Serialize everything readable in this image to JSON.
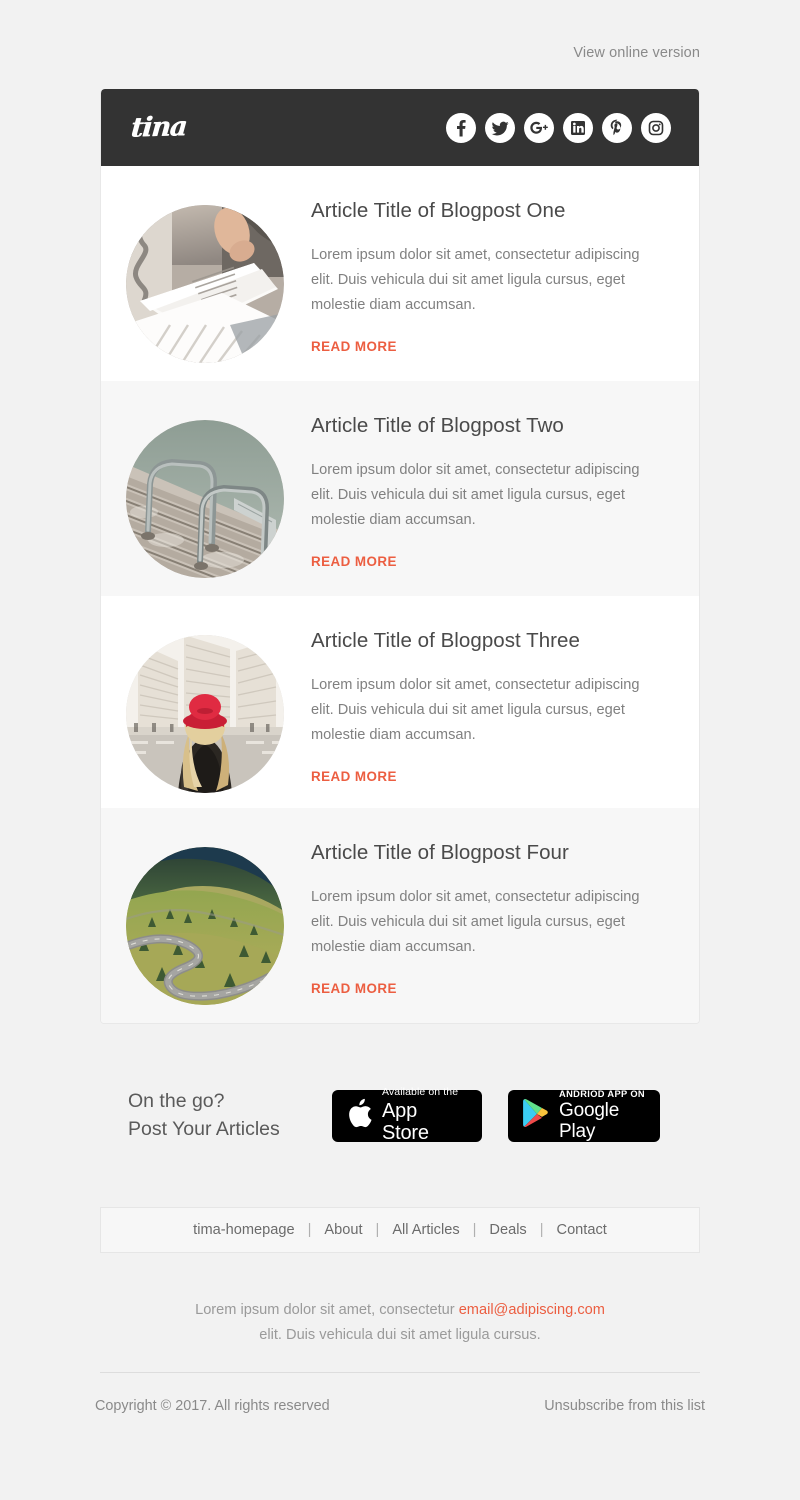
{
  "preheader": {
    "link_label": "View online version"
  },
  "header": {
    "logo_text": "tina",
    "social": [
      {
        "name": "facebook",
        "label": "Facebook"
      },
      {
        "name": "twitter",
        "label": "Twitter"
      },
      {
        "name": "googleplus",
        "label": "Google Plus"
      },
      {
        "name": "linkedin",
        "label": "LinkedIn"
      },
      {
        "name": "pinterest",
        "label": "Pinterest"
      },
      {
        "name": "instagram",
        "label": "Instagram"
      }
    ]
  },
  "articles": [
    {
      "title": "Article Title of Blogpost One",
      "body": "Lorem ipsum dolor sit amet, consectetur adipiscing elit. Duis vehicula dui sit amet ligula cursus, eget molestie diam accumsan.",
      "cta": "READ MORE",
      "image_alt": "person reading an open book"
    },
    {
      "title": "Article Title of Blogpost Two",
      "body": "Lorem ipsum dolor sit amet, consectetur adipiscing elit. Duis vehicula dui sit amet ligula cursus, eget molestie diam accumsan.",
      "cta": "READ MORE",
      "image_alt": "metal ladder railings on a wooden dock over water"
    },
    {
      "title": "Article Title of Blogpost Three",
      "body": "Lorem ipsum dolor sit amet, consectetur adipiscing elit. Duis vehicula dui sit amet ligula cursus, eget molestie diam accumsan.",
      "cta": "READ MORE",
      "image_alt": "woman in a red hat facing city buildings"
    },
    {
      "title": "Article Title of Blogpost Four",
      "body": "Lorem ipsum dolor sit amet, consectetur adipiscing elit. Duis vehicula dui sit amet ligula cursus, eget molestie diam accumsan.",
      "cta": "READ MORE",
      "image_alt": "winding mountain road through green hills"
    }
  ],
  "promo": {
    "line1": "On the go?",
    "line2": "Post Your Articles",
    "appstore": {
      "small": "Available on the",
      "big": "App Store",
      "icon": "apple-icon"
    },
    "googleplay": {
      "small": "ANDRIOD APP ON",
      "big": "Google Play",
      "icon": "google-play-icon"
    }
  },
  "footer_nav": {
    "items": [
      "tima-homepage",
      "About",
      "All Articles",
      "Deals",
      "Contact"
    ],
    "separator": "|"
  },
  "address": {
    "line1_before": "Lorem ipsum dolor sit amet, consectetur ",
    "email": "email@adipiscing.com",
    "line2": "elit. Duis vehicula dui sit amet ligula cursus."
  },
  "footer": {
    "copyright": "Copyright © 2017. All rights reserved",
    "unsubscribe": "Unsubscribe from this list"
  },
  "colors": {
    "page_bg": "#f2f2f2",
    "header_bg": "#333333",
    "accent": "#ec5e41",
    "row_alt_bg": "#f7f7f7",
    "text_muted": "#808080"
  }
}
